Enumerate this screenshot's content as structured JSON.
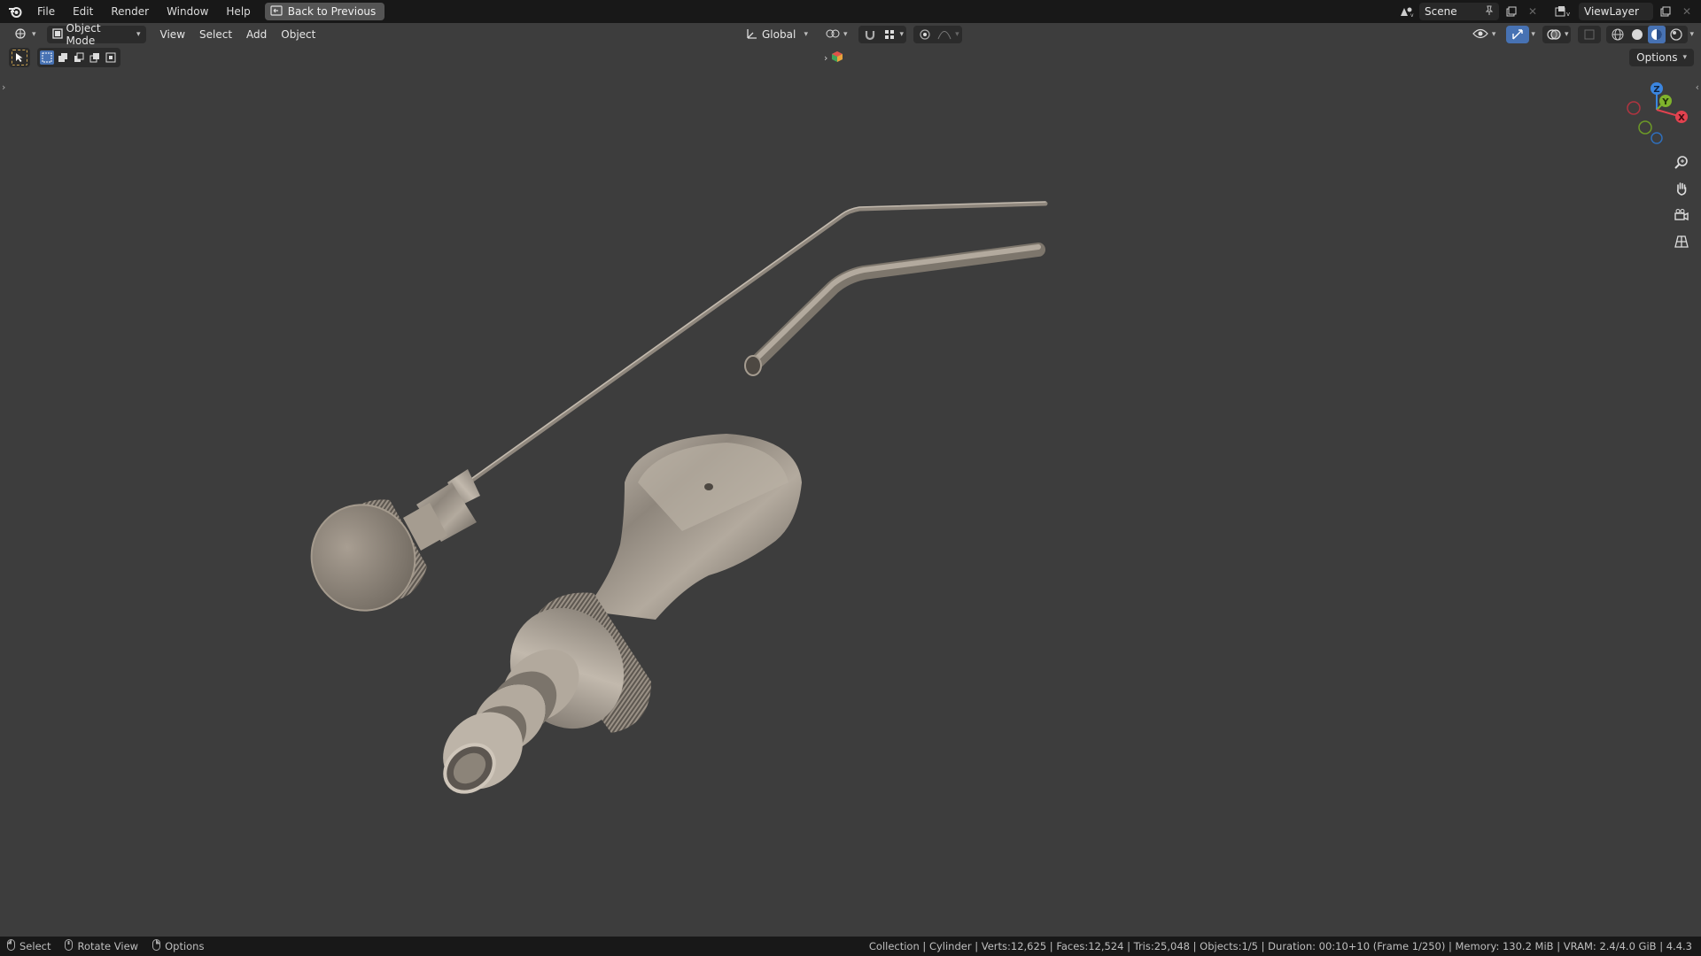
{
  "topbar": {
    "menus": [
      "File",
      "Edit",
      "Render",
      "Window",
      "Help"
    ],
    "back_button": "Back to Previous",
    "scene_name": "Scene",
    "view_layer": "ViewLayer"
  },
  "viewport_header": {
    "mode": "Object Mode",
    "menus": [
      "View",
      "Select",
      "Add",
      "Object"
    ],
    "transform_orientation": "Global",
    "options_label": "Options"
  },
  "gizmo": {
    "axes": [
      "Z",
      "Y",
      "X"
    ]
  },
  "statusbar": {
    "hints": [
      "Select",
      "Rotate View",
      "Options"
    ],
    "info": "Collection | Cylinder | Verts:12,625 | Faces:12,524 | Tris:25,048 | Objects:1/5 | Duration: 00:10+10 (Frame 1/250) | Memory: 130.2 MiB | VRAM: 2.4/4.0 GiB | 4.4.3"
  },
  "colors": {
    "menubar": "#181818",
    "viewport": "#3d3d3d",
    "accent": "#4772b3",
    "axis_x": "#e2424f",
    "axis_y": "#7fb32c",
    "axis_z": "#3b86e0"
  }
}
